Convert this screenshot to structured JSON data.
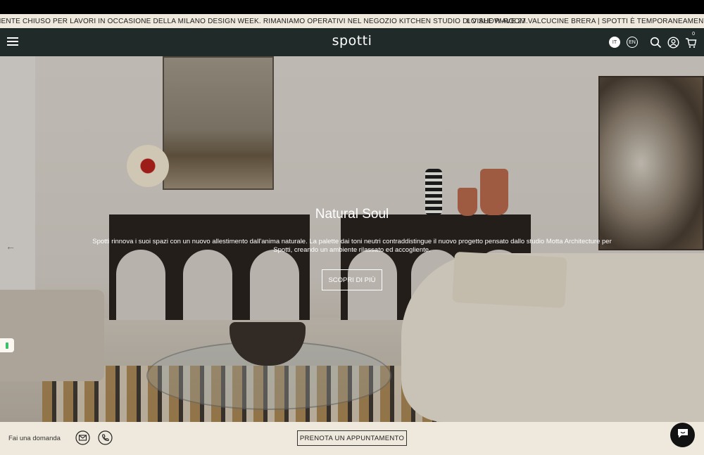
{
  "announcement": {
    "text_1": "MENTE CHIUSO PER LAVORI IN OCCASIONE DELLA MILANO DESIGN WEEK. RIMANIAMO OPERATIVI NEL NEGOZIO KITCHEN STUDIO DI VIALE PIAVE 27.",
    "text_2": "LO SHOW-ROOM VALCUCINE BRERA | SPOTTI È TEMPORANEAMENTE CHIUSO"
  },
  "header": {
    "logo": "spotti",
    "lang_it": "IT",
    "lang_en": "EN",
    "cart_count": "0",
    "icons": [
      "menu-icon",
      "search-icon",
      "account-icon",
      "cart-icon"
    ]
  },
  "hero": {
    "title": "Natural Soul",
    "description": "Spotti rinnova i suoi spazi con un nuovo allestimento dall'anima naturale. La palette dai toni neutri contraddistingue il nuovo progetto pensato dallo studio Motta Architecture per Spotti, creando un ambiente rilassato ed accogliente.",
    "cta": "SCOPRI DI PIÙ",
    "prev_arrow": "←"
  },
  "footer": {
    "ask": "Fai una domanda",
    "appointment": "PRENOTA UN APPUNTAMENTO"
  },
  "colors": {
    "navbar": "#202a29",
    "announcement_bg": "#efe8dd",
    "footer_bg": "#efe8dd",
    "chat_button": "#121212"
  }
}
